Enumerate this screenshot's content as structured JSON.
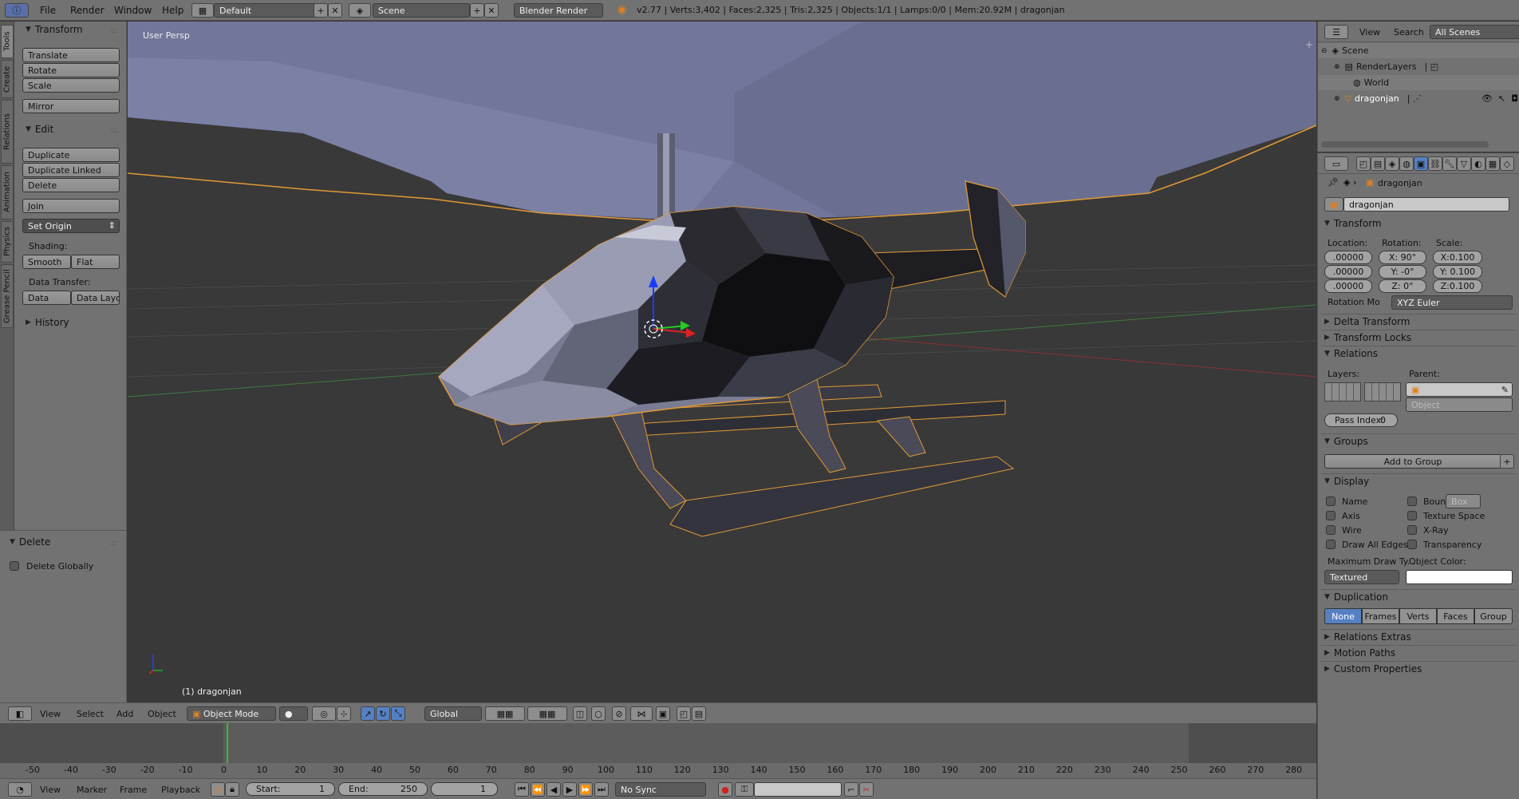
{
  "topbar": {
    "menus": [
      "File",
      "Render",
      "Window",
      "Help"
    ],
    "layout": "Default",
    "scene": "Scene",
    "engine": "Blender Render",
    "info": "v2.77 | Verts:3,402 | Faces:2,325 | Tris:2,325 | Objects:1/1 | Lamps:0/0 | Mem:20.92M | dragonjan"
  },
  "tabs": [
    "Tools",
    "Create",
    "Relations",
    "Animation",
    "Physics",
    "Grease Pencil"
  ],
  "toolshelf": {
    "transform_title": "Transform",
    "translate": "Translate",
    "rotate": "Rotate",
    "scale": "Scale",
    "mirror": "Mirror",
    "edit_title": "Edit",
    "duplicate": "Duplicate",
    "duplicate_linked": "Duplicate Linked",
    "delete": "Delete",
    "join": "Join",
    "set_origin": "Set Origin",
    "shading_label": "Shading:",
    "smooth": "Smooth",
    "flat": "Flat",
    "data_transfer_label": "Data Transfer:",
    "data": "Data",
    "data_layout": "Data Layo",
    "history_title": "History"
  },
  "operator": {
    "title": "Delete",
    "delete_globally": "Delete Globally"
  },
  "viewport": {
    "view_label": "User Persp",
    "object_label": "(1) dragonjan"
  },
  "view3d_header": {
    "view": "View",
    "select": "Select",
    "add": "Add",
    "object": "Object",
    "mode": "Object Mode",
    "orientation": "Global"
  },
  "timeline": {
    "ticks": [
      "-50",
      "-40",
      "-30",
      "-20",
      "-10",
      "0",
      "10",
      "20",
      "30",
      "40",
      "50",
      "60",
      "70",
      "80",
      "90",
      "100",
      "110",
      "120",
      "130",
      "140",
      "150",
      "160",
      "170",
      "180",
      "190",
      "200",
      "210",
      "220",
      "230",
      "240",
      "250",
      "260",
      "270",
      "280"
    ],
    "view": "View",
    "marker": "Marker",
    "frame": "Frame",
    "playback": "Playback",
    "start_label": "Start:",
    "start": "1",
    "end_label": "End:",
    "end": "250",
    "current": "1",
    "sync": "No Sync"
  },
  "outliner": {
    "view": "View",
    "search": "Search",
    "filter": "All Scenes",
    "scene": "Scene",
    "render_layers": "RenderLayers",
    "world": "World",
    "object": "dragonjan"
  },
  "properties": {
    "context_object": "dragonjan",
    "object_name": "dragonjan",
    "transform_title": "Transform",
    "location_label": "Location:",
    "rotation_label": "Rotation:",
    "scale_label": "Scale:",
    "location": [
      ".00000",
      ".00000",
      ".00000"
    ],
    "rotation": [
      "X:  90°",
      "Y:  -0°",
      "Z:   0°"
    ],
    "scale": [
      "X:0.100",
      "Y: 0.100",
      "Z:0.100"
    ],
    "rotation_mode_label": "Rotation Mo",
    "rotation_mode": "XYZ Euler",
    "delta_transform": "Delta Transform",
    "transform_locks": "Transform Locks",
    "relations": "Relations",
    "layers_label": "Layers:",
    "parent_label": "Parent:",
    "parent_type": "Object",
    "pass_index_label": "Pass Index:",
    "pass_index": "0",
    "groups": "Groups",
    "add_to_group": "Add to Group",
    "display": "Display",
    "name": "Name",
    "bounds": "Boun",
    "bounds_type": "Box",
    "axis": "Axis",
    "texture_space": "Texture Space",
    "wire": "Wire",
    "xray": "X-Ray",
    "draw_all_edges": "Draw All Edges",
    "transparency": "Transparency",
    "max_draw_type_label": "Maximum Draw Ty...",
    "object_color_label": "Object Color:",
    "max_draw_type": "Textured",
    "duplication": "Duplication",
    "dup_options": [
      "None",
      "Frames",
      "Verts",
      "Faces",
      "Group"
    ],
    "relations_extras": "Relations Extras",
    "motion_paths": "Motion Paths",
    "custom_properties": "Custom Properties"
  },
  "colors": {
    "selection_outline": "#f0a030",
    "accent": "#5680c2",
    "sky": "#70749a"
  }
}
